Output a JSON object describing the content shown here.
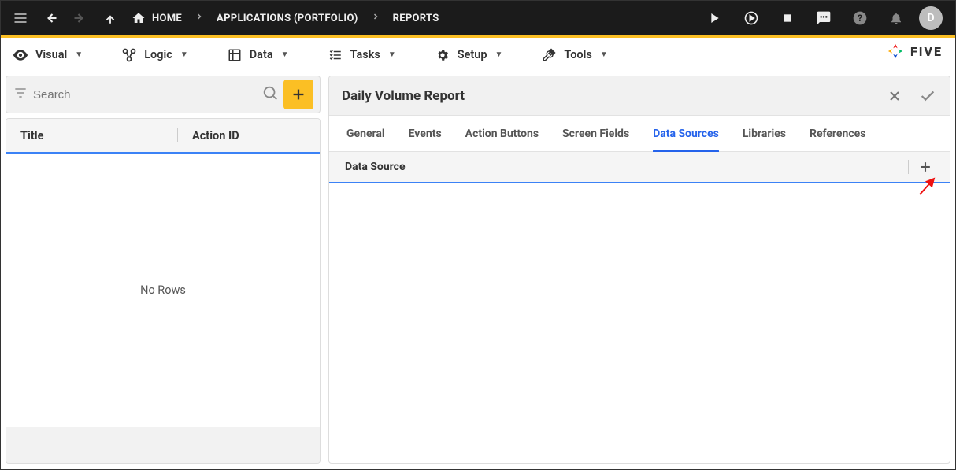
{
  "topbar": {
    "avatar_letter": "D"
  },
  "breadcrumbs": [
    {
      "label": "HOME"
    },
    {
      "label": "APPLICATIONS (PORTFOLIO)"
    },
    {
      "label": "REPORTS"
    }
  ],
  "menu": [
    {
      "label": "Visual"
    },
    {
      "label": "Logic"
    },
    {
      "label": "Data"
    },
    {
      "label": "Tasks"
    },
    {
      "label": "Setup"
    },
    {
      "label": "Tools"
    }
  ],
  "brand_text": "FIVE",
  "left": {
    "search_placeholder": "Search",
    "col_title": "Title",
    "col_action": "Action ID",
    "empty_text": "No Rows"
  },
  "right": {
    "title": "Daily Volume Report",
    "tabs": [
      {
        "label": "General",
        "active": false
      },
      {
        "label": "Events",
        "active": false
      },
      {
        "label": "Action Buttons",
        "active": false
      },
      {
        "label": "Screen Fields",
        "active": false
      },
      {
        "label": "Data Sources",
        "active": true
      },
      {
        "label": "Libraries",
        "active": false
      },
      {
        "label": "References",
        "active": false
      }
    ],
    "subhead_label": "Data Source"
  }
}
